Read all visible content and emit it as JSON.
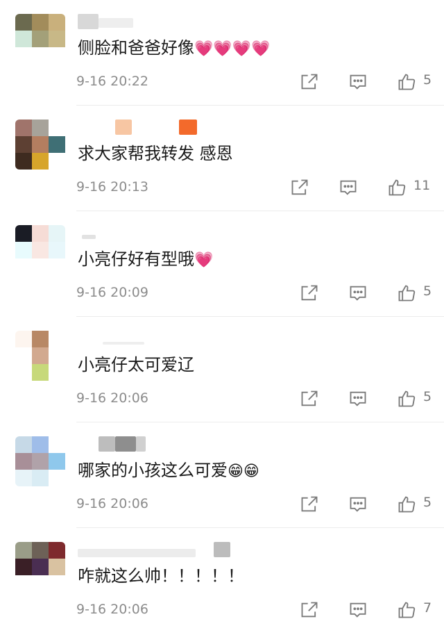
{
  "comments": [
    {
      "text": "侧脸和爸爸好像",
      "emoji": "💗💗💗💗",
      "time": "9-16 20:22",
      "likes": "5",
      "avatar": [
        "#6b6a4f",
        "#a28c5b",
        "#c9b07c",
        "#cfe7d9",
        "#a3a079",
        "#c8b887",
        "#ffffff",
        "#ffffff",
        "#ffffff"
      ]
    },
    {
      "text": "求大家帮我转发  感恩",
      "emoji": "",
      "time": "9-16 20:13",
      "likes": "11",
      "avatar": [
        "#a0746b",
        "#a7a39a",
        "#ffffff",
        "#5d4033",
        "#b47e60",
        "#3f6f75",
        "#3e2b20",
        "#d7a52b",
        "#ffffff"
      ]
    },
    {
      "text": "小亮仔好有型哦",
      "emoji": "💗",
      "time": "9-16 20:09",
      "likes": "5",
      "avatar": [
        "#1a1c25",
        "#f6dcd6",
        "#e6f5f7",
        "#e8fbfd",
        "#f9e7e2",
        "#e8f7fb",
        "#ffffff",
        "#ffffff",
        "#ffffff"
      ]
    },
    {
      "text": "小亮仔太可爱辽",
      "emoji": "",
      "time": "9-16 20:06",
      "likes": "5",
      "avatar": [
        "#fdf5ef",
        "#b88865",
        "#ffffff",
        "#ffffff",
        "#d2a98f",
        "#ffffff",
        "#ffffff",
        "#c7d97a",
        "#ffffff"
      ]
    },
    {
      "text": "哪家的小孩这么可爱",
      "emoji": "😁😁",
      "time": "9-16 20:06",
      "likes": "5",
      "avatar": [
        "#c6d9e7",
        "#9fbde9",
        "#ffffff",
        "#a88f98",
        "#b0a2a9",
        "#8fc8ec",
        "#e7f3f8",
        "#d9ecf4",
        "#ffffff"
      ]
    },
    {
      "text": "咋就这么帅！！！！！",
      "emoji": "",
      "time": "9-16 20:06",
      "likes": "7",
      "avatar": [
        "#9a9d88",
        "#6d6157",
        "#7e2a2d",
        "#3a1f26",
        "#4a2e52",
        "#d9c2a1",
        "#ffffff",
        "#ffffff",
        "#ffffff"
      ]
    }
  ],
  "colors": {
    "meta": "#8c8c8c",
    "icon": "#7a7a7a",
    "divider": "#ececec"
  }
}
